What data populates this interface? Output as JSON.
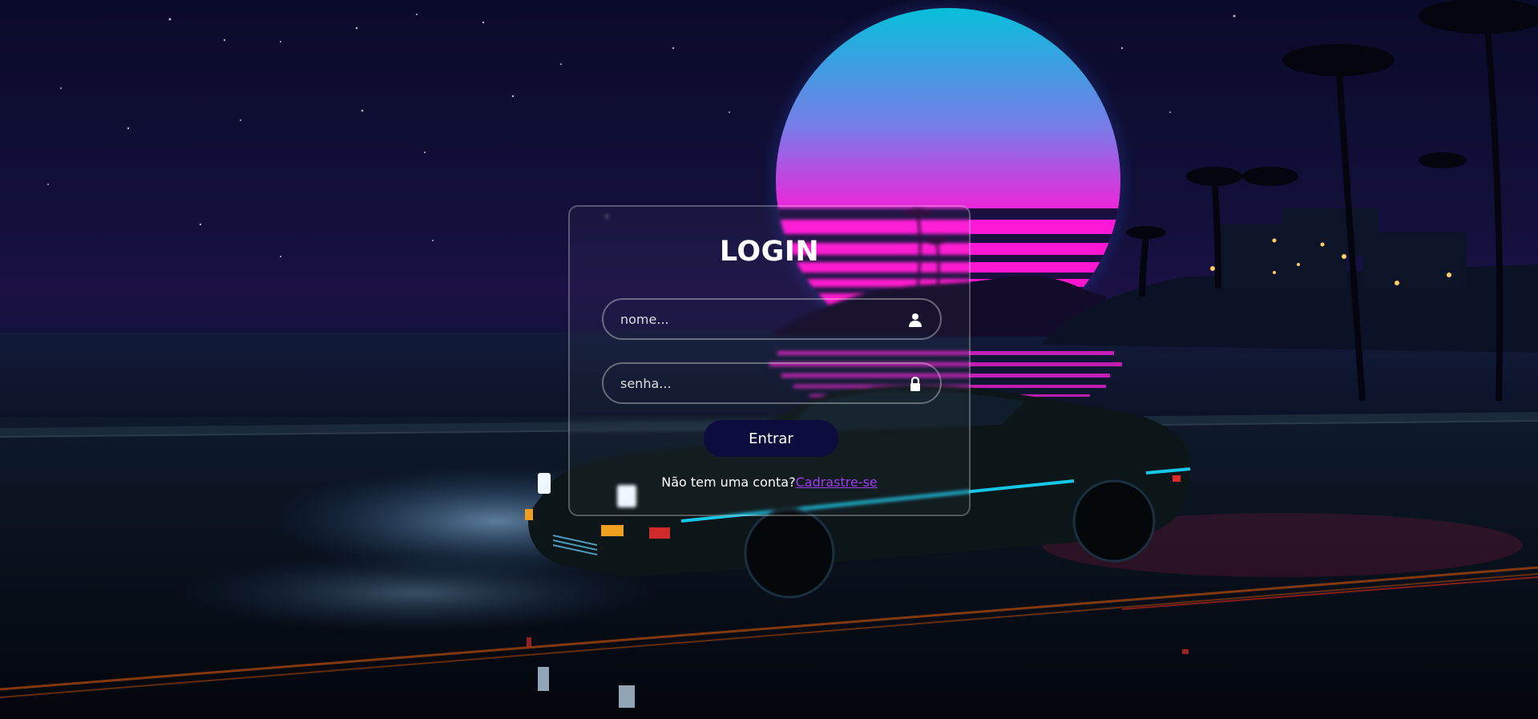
{
  "login": {
    "title": "LOGIN",
    "username_placeholder": "nome...",
    "password_placeholder": "senha...",
    "submit_label": "Entrar",
    "register_prompt": "Não tem uma conta?",
    "register_link": "Cadrastre-se"
  },
  "icons": {
    "username": "user-icon",
    "password": "lock-icon"
  },
  "colors": {
    "button_bg": "#0c0c3e",
    "link": "#9b3df0",
    "sun_top": "#00c4da",
    "sun_bottom": "#ff10e0"
  }
}
